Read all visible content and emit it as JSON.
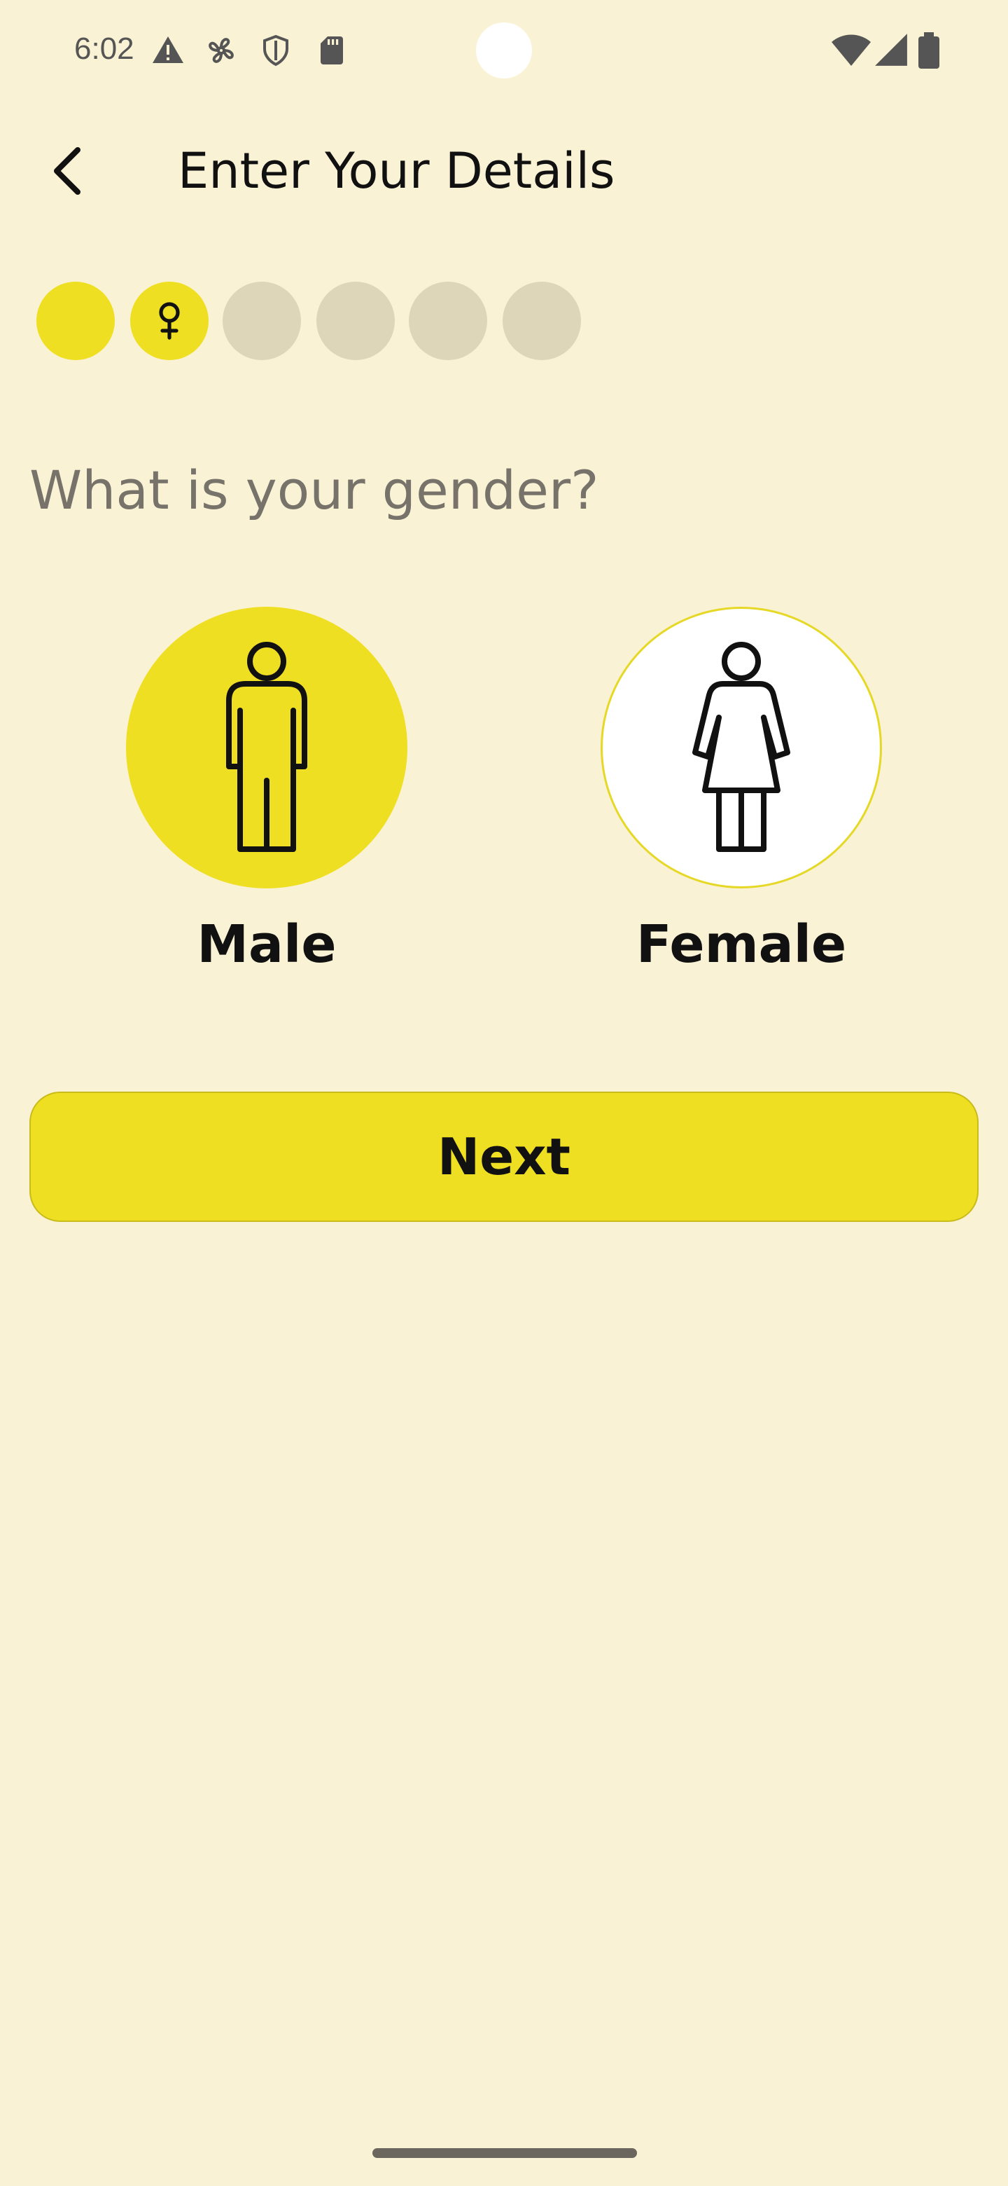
{
  "status_bar": {
    "time": "6:02",
    "left_icons": [
      "warning-icon",
      "fan-icon",
      "shield-icon",
      "sd-card-icon"
    ],
    "right_icons": [
      "wifi-icon",
      "signal-icon",
      "battery-icon"
    ]
  },
  "header": {
    "title": "Enter Your Details",
    "back_icon": "back-arrow-icon"
  },
  "progress": {
    "total_steps": 6,
    "completed_steps": 2,
    "current_step_icon": "female-symbol-icon"
  },
  "question": {
    "text": "What is your gender?"
  },
  "gender_options": [
    {
      "label": "Male",
      "icon": "male-figure-icon",
      "selected": true
    },
    {
      "label": "Female",
      "icon": "female-figure-icon",
      "selected": false
    }
  ],
  "actions": {
    "next_label": "Next"
  },
  "colors": {
    "background": "#faf2d4",
    "accent": "#efdf22",
    "inactive_step": "#ded6b9",
    "question_text": "#77736a"
  }
}
